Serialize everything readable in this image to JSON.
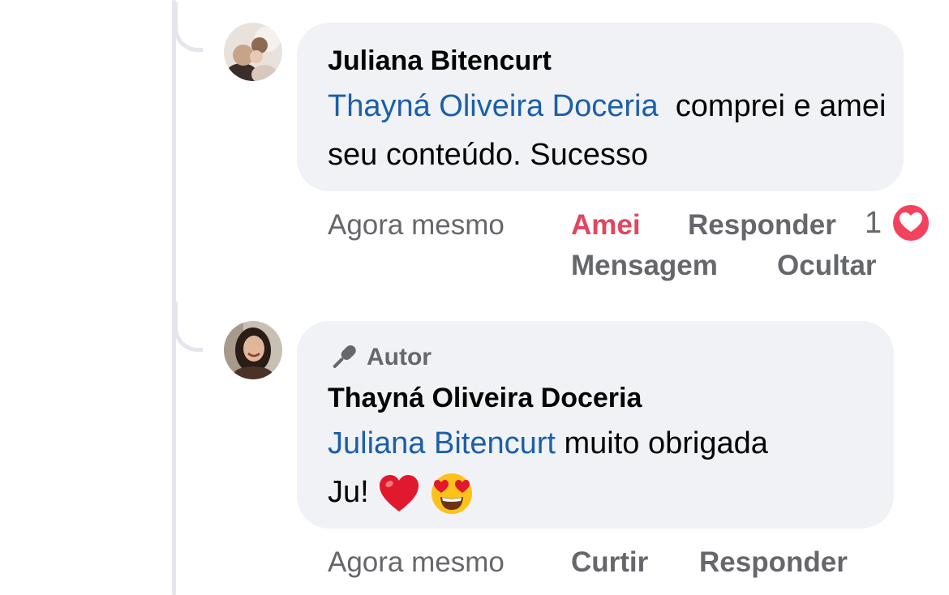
{
  "comment1": {
    "author": "Juliana Bitencurt",
    "mention": "Thayná Oliveira Doceria",
    "text": "comprei e amei seu conteúdo. Sucesso",
    "actions": {
      "time": "Agora mesmo",
      "reaction": "Amei",
      "reply": "Responder",
      "message": "Mensagem",
      "hide": "Ocultar"
    },
    "reaction_count": "1",
    "reaction_icon": "heart-icon"
  },
  "comment2": {
    "badge_label": "Autor",
    "badge_icon": "microphone-icon",
    "author": "Thayná Oliveira Doceria",
    "mention": "Juliana Bitencurt",
    "text_line1": "muito obrigada",
    "text_line2": "Ju!",
    "emojis": [
      "red-heart-emoji",
      "heart-eyes-emoji"
    ],
    "actions": {
      "time": "Agora mesmo",
      "like": "Curtir",
      "reply": "Responder"
    }
  },
  "colors": {
    "bubble": "#f0f2f5",
    "mention": "#1c5fa8",
    "loved": "#e2465f",
    "secondary_text": "#65676b",
    "heart": "#f3425f"
  }
}
